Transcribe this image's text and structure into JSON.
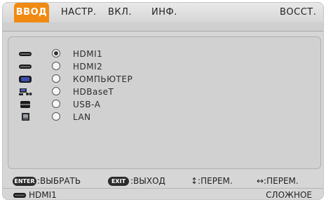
{
  "tabs": [
    {
      "label": "ВВОД",
      "active": true
    },
    {
      "label": "НАСТР.",
      "active": false
    },
    {
      "label": "ВКЛ.",
      "active": false
    },
    {
      "label": "ИНФ.",
      "active": false
    }
  ],
  "reset_tab": "ВОССТ.",
  "inputs": [
    {
      "label": "HDMI1",
      "selected": true,
      "icon": "hdmi-icon"
    },
    {
      "label": "HDMI2",
      "selected": false,
      "icon": "hdmi-icon"
    },
    {
      "label": "КОМПЬЮТЕР",
      "selected": false,
      "icon": "computer-icon"
    },
    {
      "label": "HDBaseT",
      "selected": false,
      "icon": "hdbaset-icon"
    },
    {
      "label": "USB-A",
      "selected": false,
      "icon": "usb-icon"
    },
    {
      "label": "LAN",
      "selected": false,
      "icon": "lan-icon"
    }
  ],
  "footer": {
    "enter_key": "ENTER",
    "enter_text": ":ВЫБРАТЬ",
    "exit_key": "EXIT",
    "exit_text": ":ВЫХОД",
    "updown_text": "↕:ПЕРЕМ.",
    "leftright_text": "↔:ПЕРЕМ."
  },
  "status": {
    "current_input": "HDMI1",
    "mode": "СЛОЖНОЕ"
  },
  "colors": {
    "accent": "#f08a12"
  }
}
